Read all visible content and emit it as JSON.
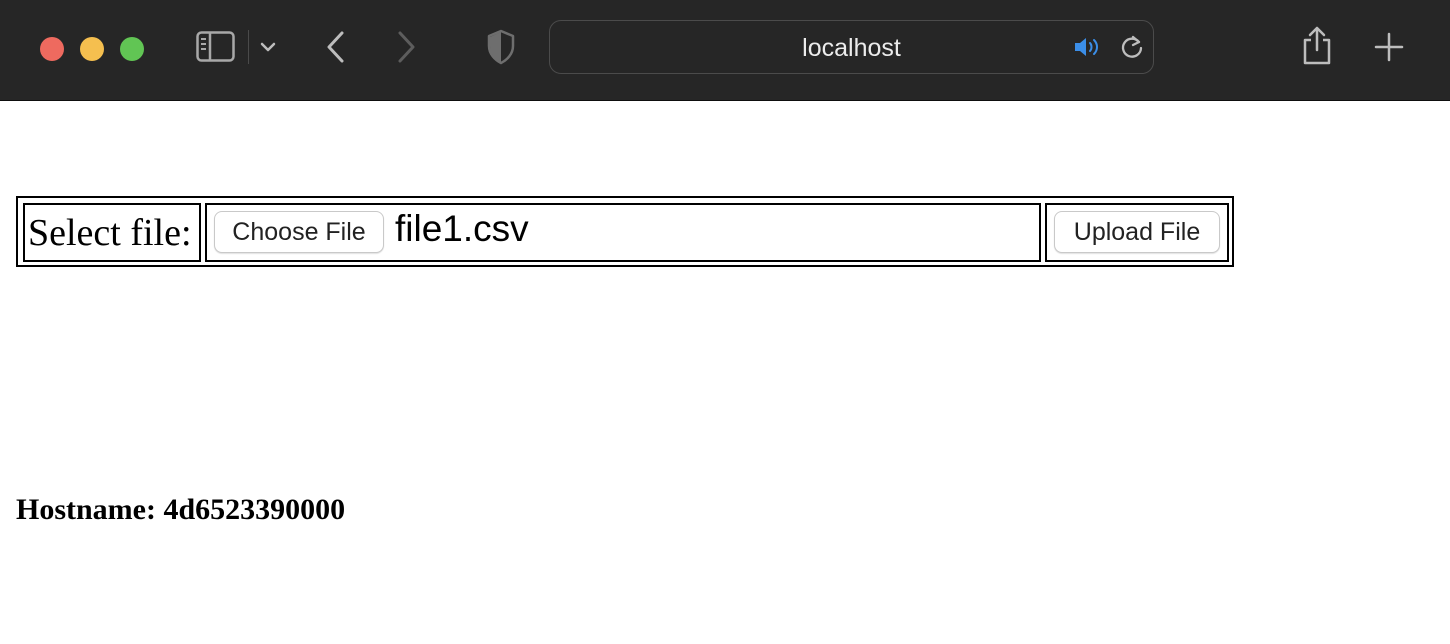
{
  "browser": {
    "address": "localhost",
    "icons": {
      "close": "close-window-icon",
      "minimize": "minimize-window-icon",
      "zoom": "zoom-window-icon",
      "sidebar": "sidebar-icon",
      "tab_overview": "chevron-down-icon",
      "back": "back-arrow-icon",
      "forward": "forward-arrow-icon",
      "privacy": "shield-icon",
      "audio": "speaker-icon",
      "reload": "reload-icon",
      "share": "share-icon",
      "new_tab": "plus-icon"
    },
    "colors": {
      "toolbar": "#262626",
      "close": "#ee6a5f",
      "minimize": "#f5bf4f",
      "zoom": "#61c554",
      "audio_accent": "#3b8ee8"
    }
  },
  "form": {
    "label": "Select file:",
    "choose_button": "Choose File",
    "file_name": "file1.csv",
    "upload_button": "Upload File"
  },
  "hostname": "Hostname: 4d6523390000"
}
